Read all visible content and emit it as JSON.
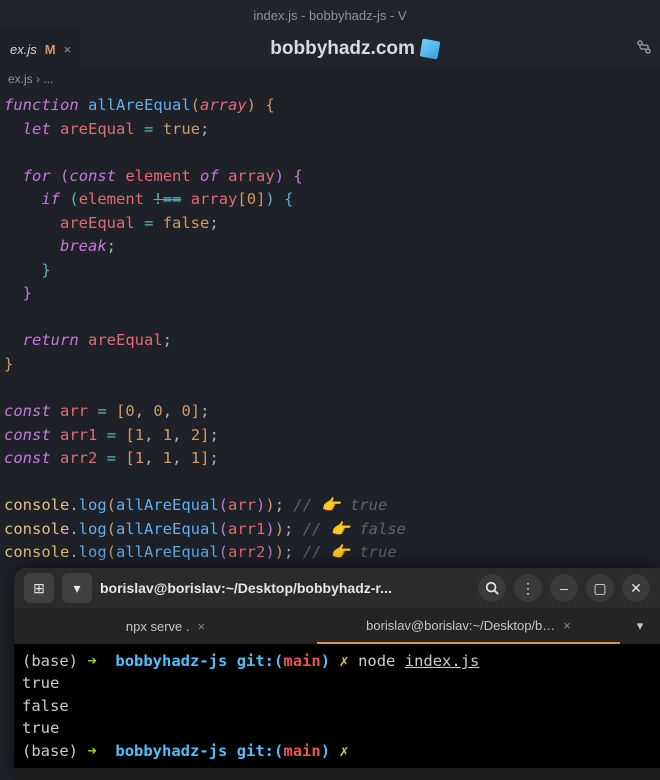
{
  "window": {
    "title": "index.js - bobbyhadz-js - V"
  },
  "tab": {
    "filename": "ex.js",
    "modified": "M",
    "close": "×"
  },
  "header": {
    "site": "bobbyhadz.com"
  },
  "breadcrumb": {
    "path": "ex.js › ..."
  },
  "code": {
    "l1_function": "function",
    "l1_name": "allAreEqual",
    "l1_param": "array",
    "l2_let": "let",
    "l2_var": "areEqual",
    "l2_eq": "=",
    "l2_true": "true",
    "l4_for": "for",
    "l4_const": "const",
    "l4_element": "element",
    "l4_of": "of",
    "l4_array": "array",
    "l5_if": "if",
    "l5_element": "element",
    "l5_neq": "!==",
    "l5_array": "array",
    "l5_zero": "0",
    "l6_areEqual": "areEqual",
    "l6_eq": "=",
    "l6_false": "false",
    "l7_break": "break",
    "l11_return": "return",
    "l11_areEqual": "areEqual",
    "l14_const": "const",
    "l14_arr": "arr",
    "l14_vals": [
      "0",
      "0",
      "0"
    ],
    "l15_const": "const",
    "l15_arr": "arr1",
    "l15_vals": [
      "1",
      "1",
      "2"
    ],
    "l16_const": "const",
    "l16_arr": "arr2",
    "l16_vals": [
      "1",
      "1",
      "1"
    ],
    "console": "console",
    "log": "log",
    "allAreEqual": "allAreEqual",
    "call_arr": "arr",
    "call_arr1": "arr1",
    "call_arr2": "arr2",
    "comment_true": "// 👉️ true",
    "comment_false": "// 👉️ false"
  },
  "terminal": {
    "icon_left": "⊞",
    "title": "borislav@borislav:~/Desktop/bobbyhadz-r...",
    "tabs": {
      "t1": "npx serve .",
      "t2": "borislav@borislav:~/Desktop/b…"
    },
    "prompt": {
      "base": "(base)",
      "arrow": "➜",
      "dir": "bobbyhadz-js",
      "git": "git:(",
      "branch": "main",
      "gitclose": ")",
      "x": "✗",
      "cmd": "node",
      "file": "index.js"
    },
    "output": {
      "l1": "true",
      "l2": "false",
      "l3": "true"
    }
  }
}
